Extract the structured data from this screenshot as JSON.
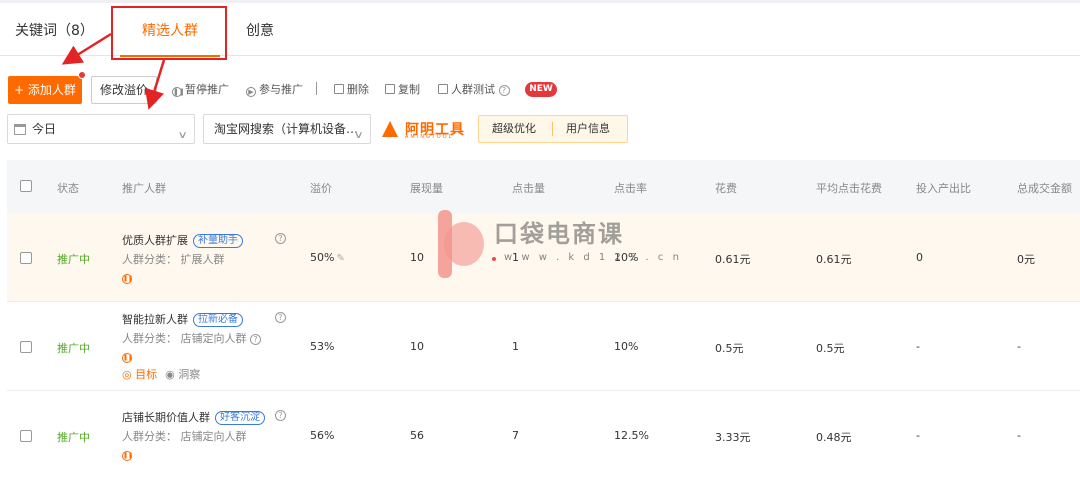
{
  "tabs": [
    {
      "label": "关键词（8）"
    },
    {
      "label": "精选人群",
      "active": true
    },
    {
      "label": "创意"
    }
  ],
  "toolbar": {
    "add_label": "+ 添加人群",
    "modify_label": "修改溢价",
    "pause_label": "暂停推广",
    "join_label": "参与推广",
    "delete_label": "删除",
    "copy_label": "复制",
    "test_label": "人群测试",
    "new_badge": "NEW"
  },
  "filters": {
    "date_value": "今日",
    "site_value": "淘宝网搜索（计算机设备…",
    "brand_logo": "阿明工具",
    "brand_sub": "AMINGTOOL",
    "optimize_label": "超级优化",
    "userinfo_label": "用户信息"
  },
  "table": {
    "headers": [
      "状态",
      "推广人群",
      "溢价",
      "展现量",
      "点击量",
      "点击率",
      "花费",
      "平均点击花费",
      "投入产出比",
      "总成交金额"
    ],
    "rows": [
      {
        "status": "推广中",
        "name": "优质人群扩展",
        "tag": "补量助手",
        "category": "人群分类： 扩展人群",
        "premium": "50%",
        "impressions": "10",
        "clicks": "1",
        "ctr": "10%",
        "cost": "0.61元",
        "avg_cpc": "0.61元",
        "roi": "0",
        "gmv": "0元"
      },
      {
        "status": "推广中",
        "name": "智能拉新人群",
        "tag": "拉新必备",
        "category": "人群分类： 店铺定向人群",
        "premium": "53%",
        "impressions": "10",
        "clicks": "1",
        "ctr": "10%",
        "cost": "0.5元",
        "avg_cpc": "0.5元",
        "roi": "-",
        "gmv": "-",
        "link_target": "目标",
        "link_insight": "洞察"
      },
      {
        "status": "推广中",
        "name": "店铺长期价值人群",
        "tag": "好客沉淀",
        "category": "人群分类： 店铺定向人群",
        "premium": "56%",
        "impressions": "56",
        "clicks": "7",
        "ctr": "12.5%",
        "cost": "3.33元",
        "avg_cpc": "0.48元",
        "roi": "-",
        "gmv": "-"
      }
    ]
  },
  "watermark": {
    "title": "口袋电商课",
    "url": "w w w . k d 1 2 3 . c n"
  },
  "colors": {
    "accent": "#ff6a00",
    "status_green": "#52a825",
    "annotation_red": "#e32424",
    "tag_blue": "#3a7bdc"
  }
}
